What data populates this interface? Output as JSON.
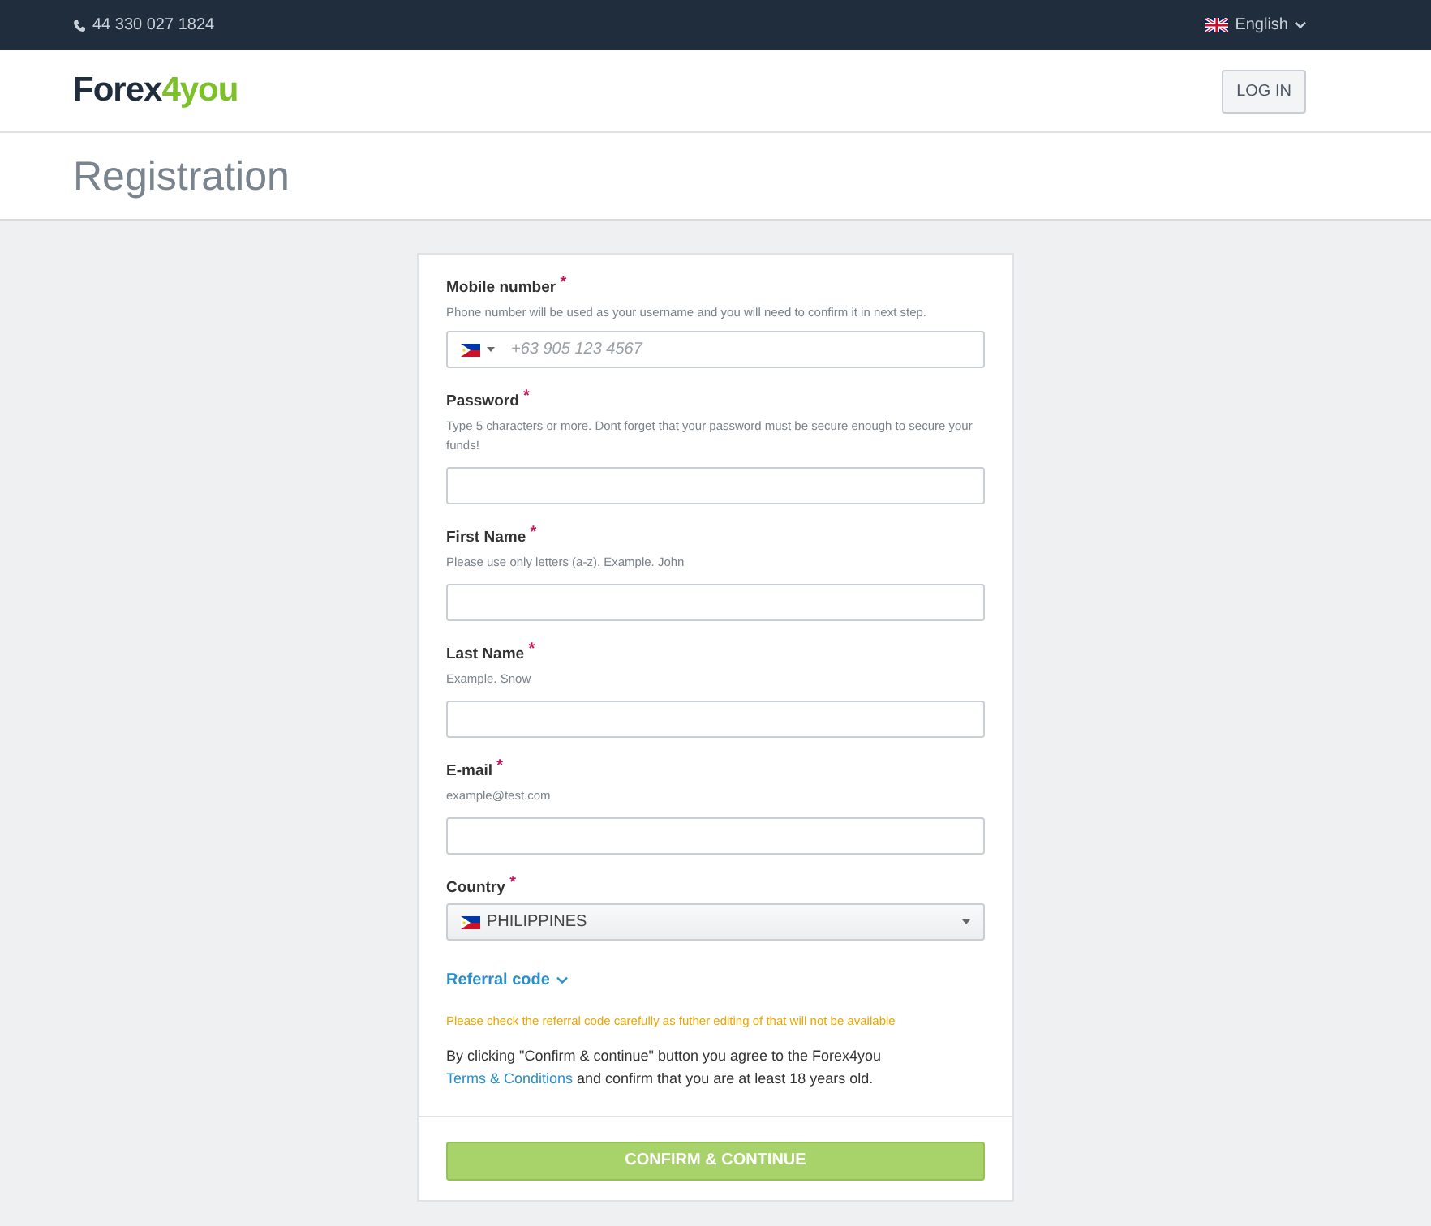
{
  "top_bar": {
    "phone": "44 330 027 1824",
    "language": "English"
  },
  "header": {
    "logo": {
      "main": "Forex",
      "accent": "4you"
    },
    "login_button": "LOG IN"
  },
  "page_title": "Registration",
  "form": {
    "fields": [
      {
        "kind": "phone",
        "label": "Mobile number",
        "required_mark": "*",
        "hint": "Phone number will be used as your username and you will need to confirm it in next step.",
        "placeholder": "+63 905 123 4567"
      },
      {
        "kind": "text",
        "label": "Password",
        "required_mark": "*",
        "hint": "Type 5 characters or more. Dont forget that your password must be secure enough to secure your funds!"
      },
      {
        "kind": "text",
        "label": "First Name",
        "required_mark": "*",
        "hint": "Please use only letters (a-z). Example. John"
      },
      {
        "kind": "text",
        "label": "Last Name",
        "required_mark": "*",
        "hint": "Example. Snow"
      },
      {
        "kind": "text",
        "label": "E-mail",
        "required_mark": "*",
        "hint": "example@test.com"
      },
      {
        "kind": "select",
        "label": "Country",
        "required_mark": "*",
        "value": "PHILIPPINES"
      }
    ],
    "referral_toggle": {
      "label": "Referral code",
      "expanded": false
    },
    "referral_warning": "Please check the referral code carefully as futher editing of that will not be available",
    "consent": {
      "before": "By clicking \"Confirm & continue\" button you agree to the Forex4you ",
      "link": "Terms & Conditions",
      "after": " and confirm that you are at least 18 years old."
    },
    "submit_button": "CONFIRM & CONTINUE"
  }
}
